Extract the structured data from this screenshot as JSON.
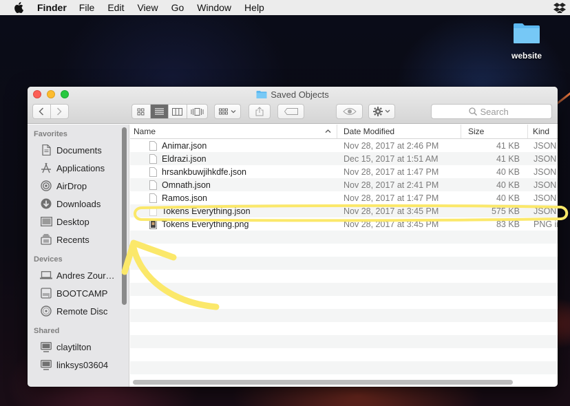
{
  "menubar": {
    "app_name": "Finder",
    "items": [
      "File",
      "Edit",
      "View",
      "Go",
      "Window",
      "Help"
    ]
  },
  "desktop": {
    "icon_label": "website"
  },
  "window": {
    "title": "Saved Objects",
    "search_placeholder": "Search"
  },
  "sidebar": {
    "favorites_title": "Favorites",
    "favorites": [
      {
        "label": "Documents",
        "icon": "documents-icon"
      },
      {
        "label": "Applications",
        "icon": "applications-icon"
      },
      {
        "label": "AirDrop",
        "icon": "airdrop-icon"
      },
      {
        "label": "Downloads",
        "icon": "downloads-icon"
      },
      {
        "label": "Desktop",
        "icon": "desktop-icon"
      },
      {
        "label": "Recents",
        "icon": "recents-icon"
      }
    ],
    "devices_title": "Devices",
    "devices": [
      {
        "label": "Andres Zour…",
        "icon": "laptop-icon"
      },
      {
        "label": "BOOTCAMP",
        "icon": "drive-icon"
      },
      {
        "label": "Remote Disc",
        "icon": "disc-icon"
      }
    ],
    "shared_title": "Shared",
    "shared": [
      {
        "label": "claytilton",
        "icon": "network-computer-icon"
      },
      {
        "label": "linksys03604",
        "icon": "network-computer-icon"
      }
    ]
  },
  "columns": {
    "name": "Name",
    "date": "Date Modified",
    "size": "Size",
    "kind": "Kind"
  },
  "files": [
    {
      "name": "Animar.json",
      "date": "Nov 28, 2017 at 2:46 PM",
      "size": "41 KB",
      "kind": "JSON"
    },
    {
      "name": "Eldrazi.json",
      "date": "Dec 15, 2017 at 1:51 AM",
      "size": "41 KB",
      "kind": "JSON"
    },
    {
      "name": "hrsankbuwjihkdfe.json",
      "date": "Nov 28, 2017 at 1:47 PM",
      "size": "40 KB",
      "kind": "JSON"
    },
    {
      "name": "Omnath.json",
      "date": "Nov 28, 2017 at 2:41 PM",
      "size": "40 KB",
      "kind": "JSON"
    },
    {
      "name": "Ramos.json",
      "date": "Nov 28, 2017 at 1:47 PM",
      "size": "40 KB",
      "kind": "JSON"
    },
    {
      "name": "Tokens Everything.json",
      "date": "Nov 28, 2017 at 3:45 PM",
      "size": "575 KB",
      "kind": "JSON"
    },
    {
      "name": "Tokens Everything.png",
      "date": "Nov 28, 2017 at 3:45 PM",
      "size": "83 KB",
      "kind": "PNG image"
    }
  ],
  "colors": {
    "annotation": "#fbe86a",
    "close": "#fc5f57",
    "minimize": "#fdbc2e",
    "maximize": "#28c840",
    "folder": "#5cb8f0"
  }
}
